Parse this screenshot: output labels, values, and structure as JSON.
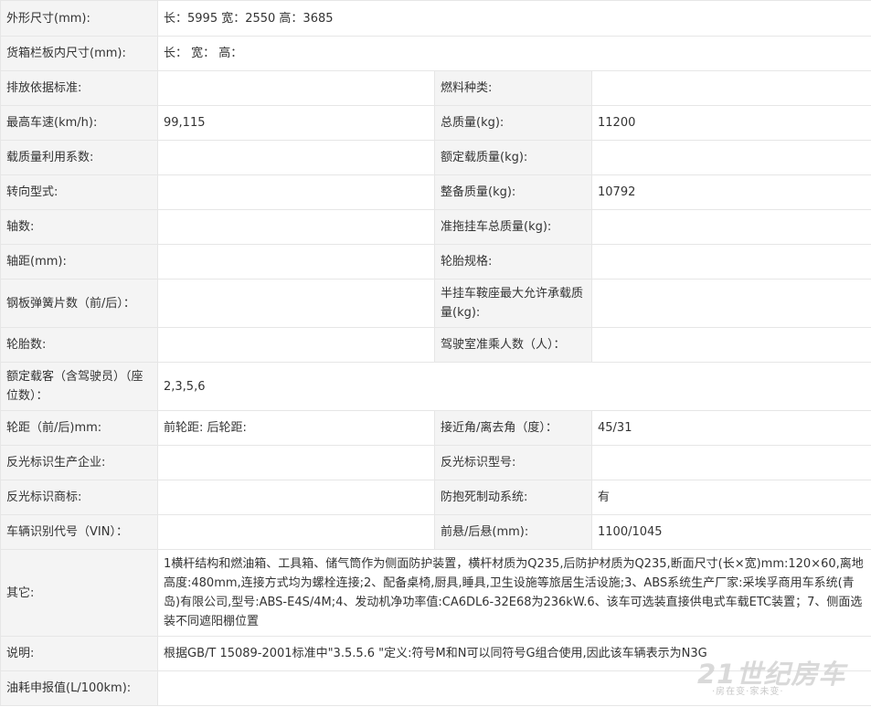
{
  "rows": [
    {
      "label": "外形尺寸(mm):",
      "value": "长：5995 宽：2550 高：3685"
    },
    {
      "label": "货箱栏板内尺寸(mm):",
      "value": "长：   宽：   高："
    },
    {
      "label": "排放依据标准:",
      "value": "",
      "label2": "燃料种类:",
      "value2": ""
    },
    {
      "label": "最高车速(km/h):",
      "value": "99,115",
      "label2": "总质量(kg):",
      "value2": "11200"
    },
    {
      "label": "载质量利用系数:",
      "value": "",
      "label2": "额定载质量(kg):",
      "value2": ""
    },
    {
      "label": "转向型式:",
      "value": "",
      "label2": "整备质量(kg):",
      "value2": "10792"
    },
    {
      "label": "轴数:",
      "value": "",
      "label2": "准拖挂车总质量(kg):",
      "value2": ""
    },
    {
      "label": "轴距(mm):",
      "value": "",
      "label2": "轮胎规格:",
      "value2": ""
    },
    {
      "label": "钢板弹簧片数（前/后）：",
      "value": "",
      "label2": "半挂车鞍座最大允许承载质量(kg):",
      "value2": ""
    },
    {
      "label": "轮胎数:",
      "value": "",
      "label2": "驾驶室准乘人数（人）：",
      "value2": ""
    },
    {
      "label": "额定载客（含驾驶员）（座位数）：",
      "value": "2,3,5,6"
    },
    {
      "label": "轮距（前/后)mm:",
      "value": "前轮距: 后轮距:",
      "label2": "接近角/离去角（度）：",
      "value2": "45/31"
    },
    {
      "label": "反光标识生产企业:",
      "value": "",
      "label2": "反光标识型号:",
      "value2": ""
    },
    {
      "label": "反光标识商标:",
      "value": "",
      "label2": "防抱死制动系统:",
      "value2": "有"
    },
    {
      "label": "车辆识别代号（VIN）：",
      "value": "",
      "label2": "前悬/后悬(mm):",
      "value2": "1100/1045"
    },
    {
      "label": "其它:",
      "value": "1横杆结构和燃油箱、工具箱、储气筒作为侧面防护装置，横杆材质为Q235,后防护材质为Q235,断面尺寸(长×宽)mm:120×60,离地高度:480mm,连接方式均为螺栓连接;2、配备桌椅,厨具,睡具,卫生设施等旅居生活设施;3、ABS系统生产厂家:采埃孚商用车系统(青岛)有限公司,型号:ABS-E4S/4M;4、发动机净功率值:CA6DL6-32E68为236kW.6、该车可选装直接供电式车载ETC装置；7、侧面选装不同遮阳棚位置"
    },
    {
      "label": "说明:",
      "value": "根据GB/T 15089-2001标准中\"3.5.5.6 \"定义:符号M和N可以同符号G组合使用,因此该车辆表示为N3G"
    },
    {
      "label": "油耗申报值(L/100km):",
      "value": ""
    }
  ],
  "watermark": {
    "main": "21世纪房车",
    "sub": "·房在变·家未变·"
  }
}
